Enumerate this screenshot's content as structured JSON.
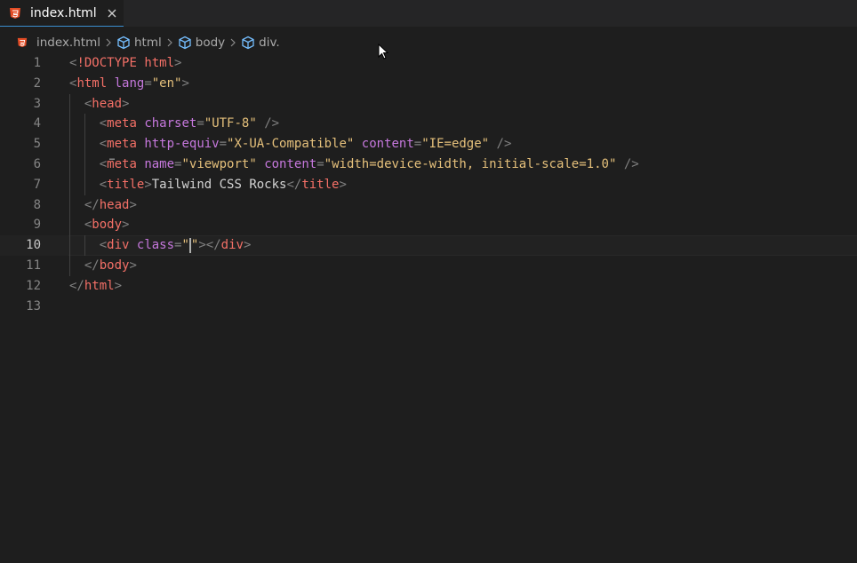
{
  "tab": {
    "title": "index.html",
    "file_icon": "html5-icon",
    "close_icon": "close-icon"
  },
  "breadcrumb": {
    "items": [
      {
        "label": "index.html",
        "icon": "html5-icon"
      },
      {
        "label": "html",
        "icon": "cube-icon"
      },
      {
        "label": "body",
        "icon": "cube-icon"
      },
      {
        "label": "div.",
        "icon": "cube-icon"
      }
    ]
  },
  "editor": {
    "current_line": 10,
    "lines": [
      {
        "n": "1",
        "tokens": [
          [
            "p",
            "<"
          ],
          [
            "r",
            "!DOCTYPE"
          ],
          [
            "t",
            " "
          ],
          [
            "r",
            "html"
          ],
          [
            "p",
            ">"
          ]
        ]
      },
      {
        "n": "2",
        "tokens": [
          [
            "p",
            "<"
          ],
          [
            "g",
            "html"
          ],
          [
            "t",
            " "
          ],
          [
            "a",
            "lang"
          ],
          [
            "p",
            "="
          ],
          [
            "s",
            "\"en\""
          ],
          [
            "p",
            ">"
          ]
        ]
      },
      {
        "n": "3",
        "tokens": [
          [
            "t",
            "  "
          ],
          [
            "p",
            "<"
          ],
          [
            "g",
            "head"
          ],
          [
            "p",
            ">"
          ]
        ]
      },
      {
        "n": "4",
        "tokens": [
          [
            "t",
            "    "
          ],
          [
            "p",
            "<"
          ],
          [
            "g",
            "meta"
          ],
          [
            "t",
            " "
          ],
          [
            "a",
            "charset"
          ],
          [
            "p",
            "="
          ],
          [
            "s",
            "\"UTF-8\""
          ],
          [
            "t",
            " "
          ],
          [
            "p",
            "/>"
          ]
        ]
      },
      {
        "n": "5",
        "tokens": [
          [
            "t",
            "    "
          ],
          [
            "p",
            "<"
          ],
          [
            "g",
            "meta"
          ],
          [
            "t",
            " "
          ],
          [
            "a",
            "http-equiv"
          ],
          [
            "p",
            "="
          ],
          [
            "s",
            "\"X-UA-Compatible\""
          ],
          [
            "t",
            " "
          ],
          [
            "a",
            "content"
          ],
          [
            "p",
            "="
          ],
          [
            "s",
            "\"IE=edge\""
          ],
          [
            "t",
            " "
          ],
          [
            "p",
            "/>"
          ]
        ]
      },
      {
        "n": "6",
        "tokens": [
          [
            "t",
            "    "
          ],
          [
            "p",
            "<"
          ],
          [
            "g",
            "meta"
          ],
          [
            "t",
            " "
          ],
          [
            "a",
            "name"
          ],
          [
            "p",
            "="
          ],
          [
            "s",
            "\"viewport\""
          ],
          [
            "t",
            " "
          ],
          [
            "a",
            "content"
          ],
          [
            "p",
            "="
          ],
          [
            "s",
            "\"width=device-width, initial-scale=1.0\""
          ],
          [
            "t",
            " "
          ],
          [
            "p",
            "/>"
          ]
        ]
      },
      {
        "n": "7",
        "tokens": [
          [
            "t",
            "    "
          ],
          [
            "p",
            "<"
          ],
          [
            "g",
            "title"
          ],
          [
            "p",
            ">"
          ],
          [
            "t",
            "Tailwind CSS Rocks"
          ],
          [
            "p",
            "</"
          ],
          [
            "g",
            "title"
          ],
          [
            "p",
            ">"
          ]
        ]
      },
      {
        "n": "8",
        "tokens": [
          [
            "t",
            "  "
          ],
          [
            "p",
            "</"
          ],
          [
            "g",
            "head"
          ],
          [
            "p",
            ">"
          ]
        ]
      },
      {
        "n": "9",
        "tokens": [
          [
            "t",
            "  "
          ],
          [
            "p",
            "<"
          ],
          [
            "g",
            "body"
          ],
          [
            "p",
            ">"
          ]
        ]
      },
      {
        "n": "10",
        "tokens": [
          [
            "t",
            "    "
          ],
          [
            "p",
            "<"
          ],
          [
            "g",
            "div"
          ],
          [
            "t",
            " "
          ],
          [
            "a",
            "class"
          ],
          [
            "p",
            "="
          ],
          [
            "s",
            "\""
          ],
          [
            "c",
            ""
          ],
          [
            "s",
            "\""
          ],
          [
            "p",
            ">"
          ],
          [
            "p",
            "</"
          ],
          [
            "g",
            "div"
          ],
          [
            "p",
            ">"
          ]
        ]
      },
      {
        "n": "11",
        "tokens": [
          [
            "t",
            "  "
          ],
          [
            "p",
            "</"
          ],
          [
            "g",
            "body"
          ],
          [
            "p",
            ">"
          ]
        ]
      },
      {
        "n": "12",
        "tokens": [
          [
            "p",
            "</"
          ],
          [
            "g",
            "html"
          ],
          [
            "p",
            ">"
          ]
        ]
      },
      {
        "n": "13",
        "tokens": []
      }
    ]
  },
  "colors": {
    "background": "#1e1e1e",
    "tab_bar": "#252526",
    "tag": "#f47067",
    "attribute": "#c678dd",
    "string": "#e5c07b",
    "punctuation": "#808080",
    "html_icon": "#e44d26",
    "cube_icon": "#75beff"
  }
}
